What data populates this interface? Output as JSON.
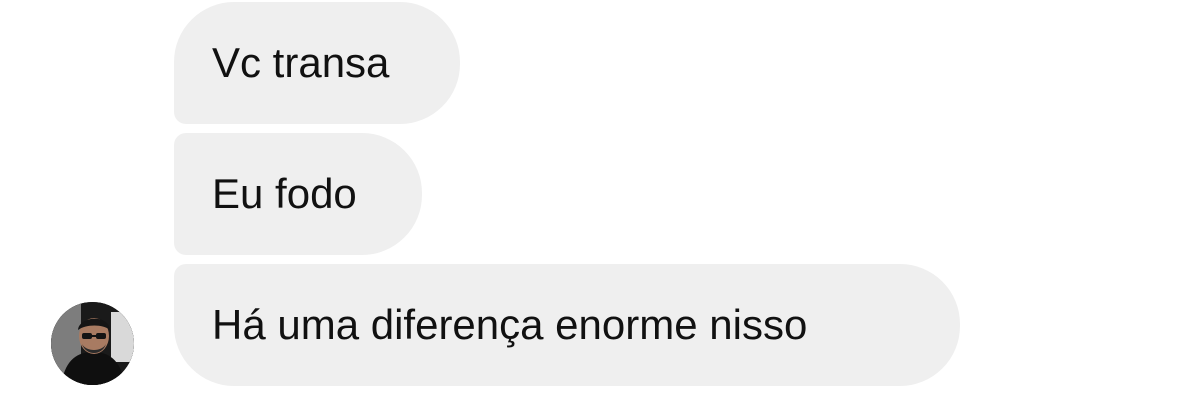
{
  "messages": [
    {
      "text": "Vc transa"
    },
    {
      "text": "Eu fodo"
    },
    {
      "text": "Há uma diferença enorme nisso"
    }
  ],
  "avatar": {
    "icon": "user-avatar-photo"
  },
  "colors": {
    "bubble_bg": "#efefef",
    "text": "#111111",
    "background": "#ffffff"
  }
}
